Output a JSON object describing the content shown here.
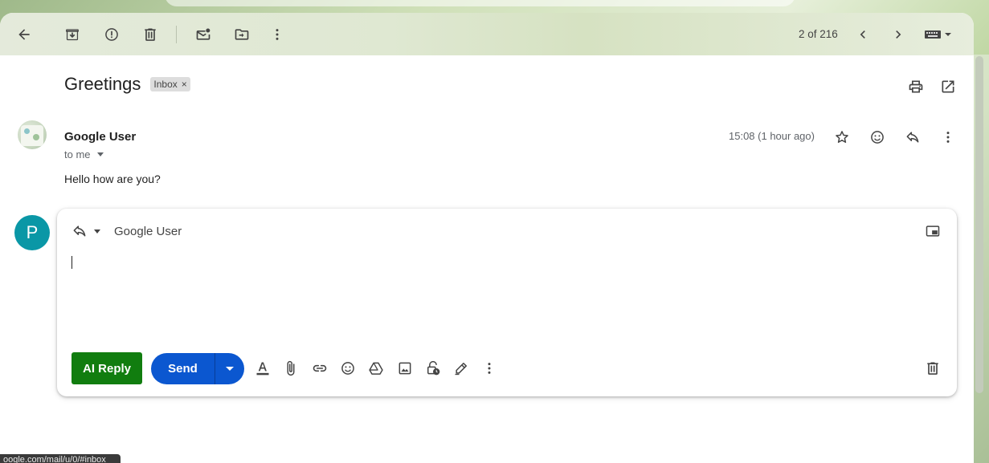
{
  "toolbar": {
    "back": "back-arrow-icon",
    "archive": "archive-icon",
    "report_spam": "report-spam-icon",
    "delete": "trash-icon",
    "mark_unread": "mark-unread-icon",
    "move_to": "move-to-icon",
    "more": "more-vert-icon",
    "pager_text": "2 of 216",
    "keyboard": "keyboard-icon"
  },
  "thread": {
    "subject": "Greetings",
    "label": "Inbox",
    "label_remove": "×"
  },
  "message": {
    "sender_name": "Google User",
    "recipient_summary": "to me",
    "timestamp": "15:08 (1 hour ago)",
    "body": "Hello how are you?"
  },
  "reply": {
    "avatar_letter": "P",
    "recipient": "Google User",
    "ai_reply_label": "AI Reply",
    "send_label": "Send"
  },
  "status_bar": {
    "url": "oogle.com/mail/u/0/#inbox"
  },
  "colors": {
    "ai_reply": "#117d0f",
    "send": "#0b57d0",
    "avatar": "#0a97a6"
  }
}
